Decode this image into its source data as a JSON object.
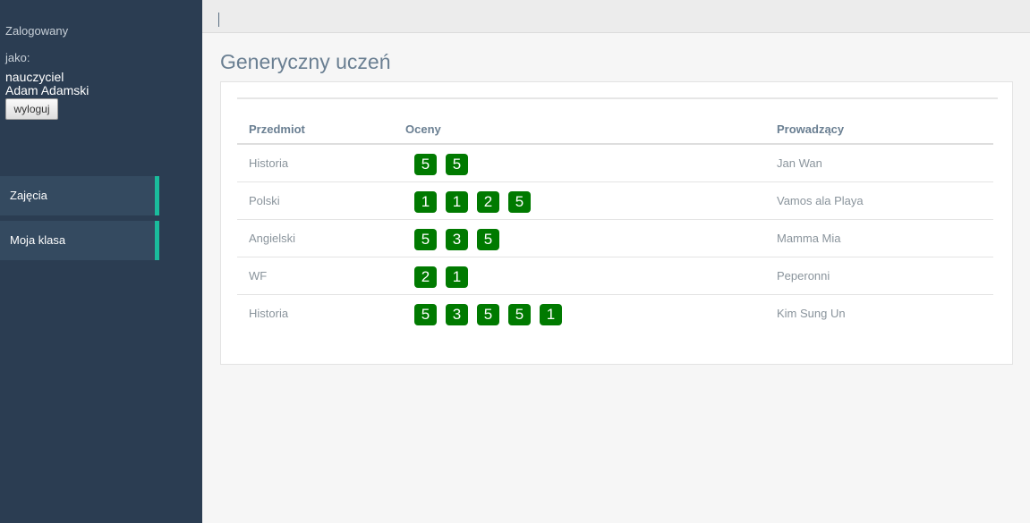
{
  "sidebar": {
    "login_label": "Zalogowany",
    "as_label": "jako:",
    "role": "nauczyciel",
    "username": "Adam Adamski",
    "logout_label": "wyloguj",
    "nav": [
      {
        "label": "Zajęcia"
      },
      {
        "label": "Moja klasa"
      }
    ],
    "accent_color": "#1abc9c"
  },
  "topbar": {
    "separator": "|"
  },
  "main": {
    "title": "Generyczny uczeń",
    "table": {
      "headers": [
        "Przedmiot",
        "Oceny",
        "Prowadzący"
      ],
      "rows": [
        {
          "subject": "Historia",
          "grades": [
            "5",
            "5"
          ],
          "teacher": "Jan Wan"
        },
        {
          "subject": "Polski",
          "grades": [
            "1",
            "1",
            "2",
            "5"
          ],
          "teacher": "Vamos ala Playa"
        },
        {
          "subject": "Angielski",
          "grades": [
            "5",
            "3",
            "5"
          ],
          "teacher": "Mamma Mia"
        },
        {
          "subject": "WF",
          "grades": [
            "2",
            "1"
          ],
          "teacher": "Peperonni"
        },
        {
          "subject": "Historia",
          "grades": [
            "5",
            "3",
            "5",
            "5",
            "1"
          ],
          "teacher": "Kim Sung Un"
        }
      ],
      "grade_badge_color": "#007a00"
    }
  }
}
